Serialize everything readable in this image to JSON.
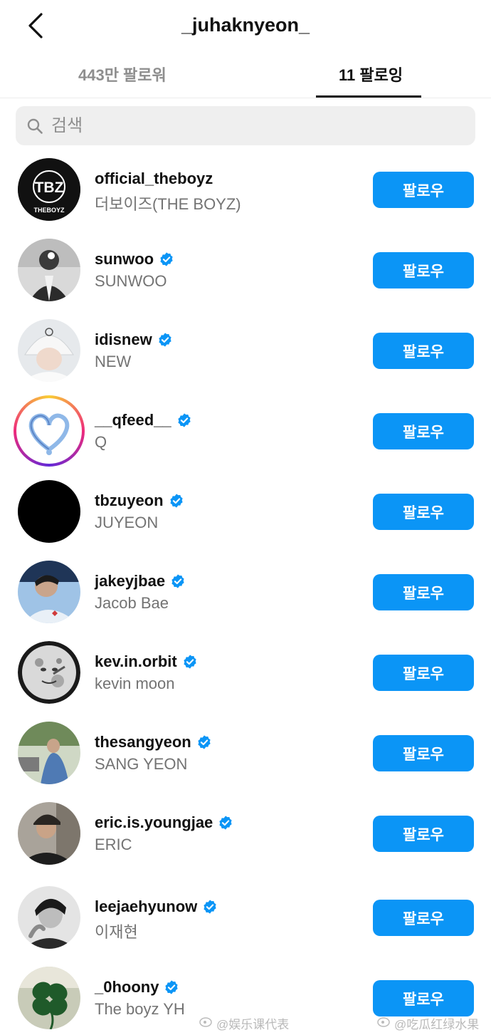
{
  "header": {
    "title": "_juhaknyeon_"
  },
  "tabs": [
    {
      "label": "443만 팔로워"
    },
    {
      "label": "11 팔로잉"
    }
  ],
  "search": {
    "placeholder": "검색"
  },
  "follow_label": "팔로우",
  "accent_color": "#0b95f6",
  "accounts": [
    {
      "username": "official_theboyz",
      "name": "더보이즈(THE BOYZ)",
      "verified": false,
      "avatar_logo": "TBZ",
      "avatar_logo_sub": "THEBOYZ"
    },
    {
      "username": "sunwoo",
      "name": "SUNWOO",
      "verified": true
    },
    {
      "username": "idisnew",
      "name": "NEW",
      "verified": true
    },
    {
      "username": "__qfeed__",
      "name": "Q",
      "verified": true,
      "story_ring": true
    },
    {
      "username": "tbzuyeon",
      "name": "JUYEON",
      "verified": true
    },
    {
      "username": "jakeyjbae",
      "name": "Jacob Bae",
      "verified": true
    },
    {
      "username": "kev.in.orbit",
      "name": "kevin moon",
      "verified": true
    },
    {
      "username": "thesangyeon",
      "name": "SANG YEON",
      "verified": true
    },
    {
      "username": "eric.is.youngjae",
      "name": "ERIC",
      "verified": true
    },
    {
      "username": "leejaehyunow",
      "name": "이재현",
      "verified": true
    },
    {
      "username": "_0hoony",
      "name": "The boyz YH",
      "verified": true
    }
  ],
  "watermarks": [
    "@娱乐课代表",
    "@吃瓜红绿水果"
  ]
}
